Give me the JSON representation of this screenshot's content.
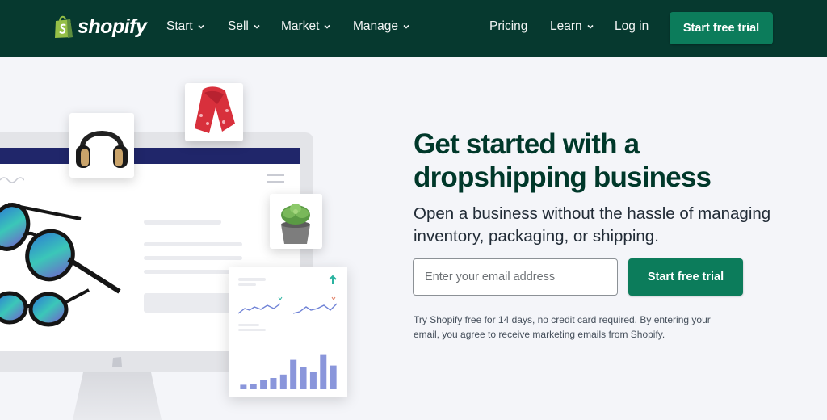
{
  "brand": {
    "name": "shopify",
    "logo_icon": "shopping-bag-icon",
    "color_green": "#0c7c5b",
    "nav_bg": "#06392f",
    "title_color": "#00382a"
  },
  "nav": {
    "left_items": [
      {
        "label": "Start",
        "icon": "chevron-down-icon"
      },
      {
        "label": "Sell",
        "icon": "chevron-down-icon"
      },
      {
        "label": "Market",
        "icon": "chevron-down-icon"
      },
      {
        "label": "Manage",
        "icon": "chevron-down-icon"
      }
    ],
    "pricing": "Pricing",
    "learn": "Learn",
    "login": "Log in",
    "cta": "Start free trial"
  },
  "hero": {
    "title": "Get started with a dropshipping business",
    "subtitle": "Open a business without the hassle of managing inventory, packaging, or shipping.",
    "email_placeholder": "Enter your email address",
    "email_value": "",
    "cta": "Start free trial",
    "disclaimer": "Try Shopify free for 14 days, no credit card required. By entering your email, you agree to receive marketing emails from Shopify."
  },
  "illustration": {
    "product_cards": [
      "headphones",
      "red scarf",
      "succulent plant",
      "sunglasses"
    ],
    "stats_bars": [
      0.08,
      0.1,
      0.16,
      0.2,
      0.26,
      0.52,
      0.4,
      0.3,
      0.62,
      0.42
    ],
    "up_arrow_icon": "arrow-up-icon"
  }
}
